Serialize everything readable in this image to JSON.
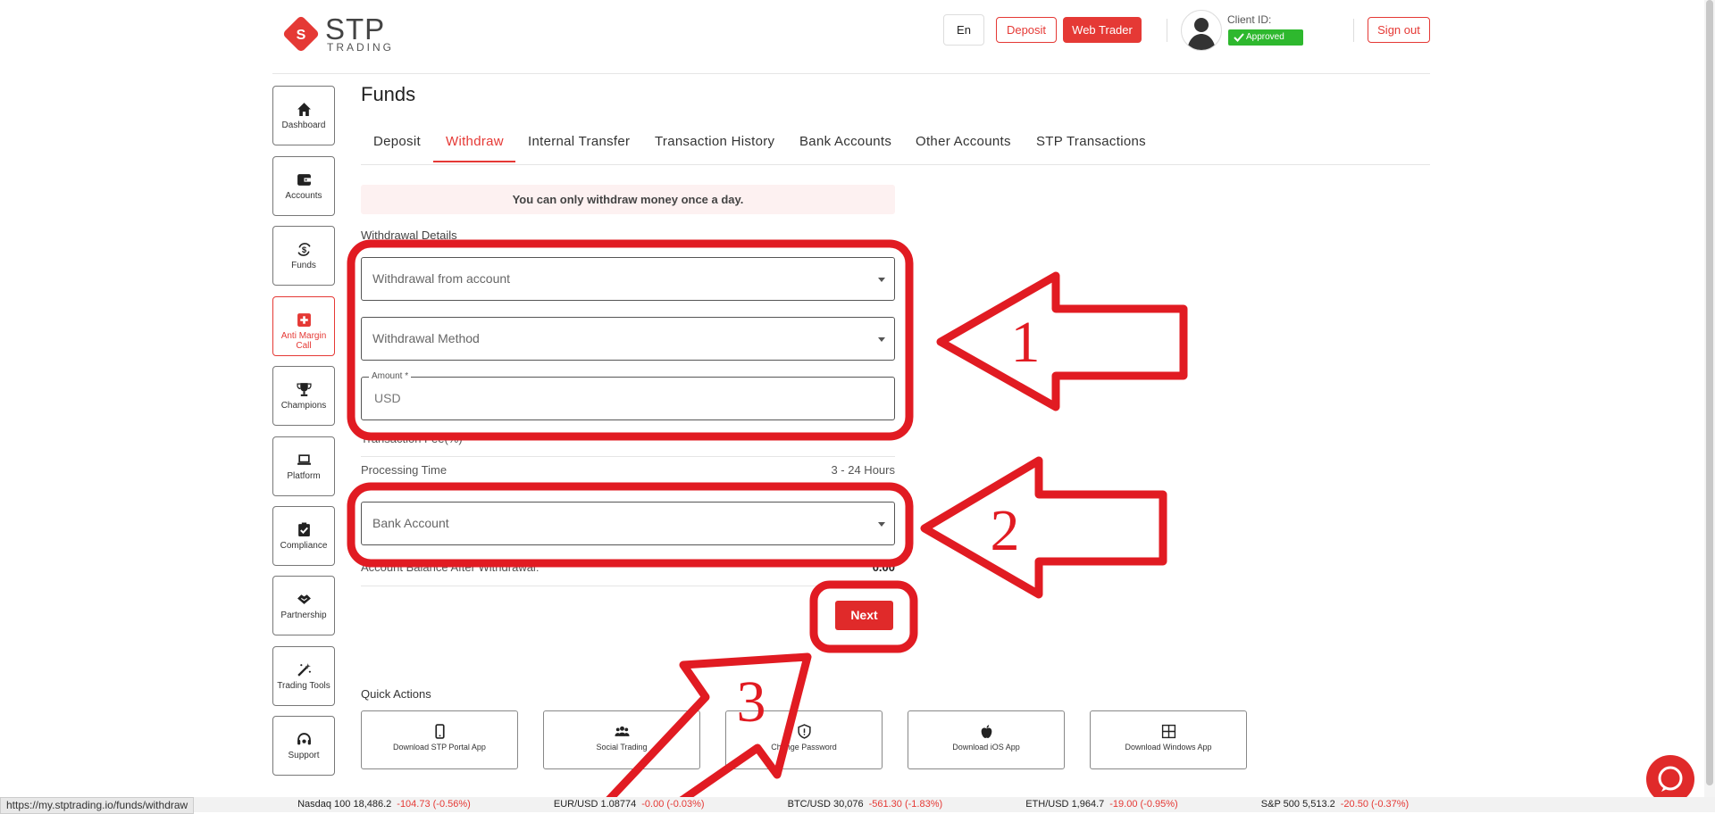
{
  "header": {
    "logo_main": "STP",
    "logo_sub": "TRADING",
    "lang": "En",
    "deposit": "Deposit",
    "web_trader": "Web Trader",
    "client_id_label": "Client ID:",
    "status": "Approved",
    "sign_out": "Sign out"
  },
  "sidebar": {
    "items": [
      {
        "label": "Dashboard",
        "icon": "home-icon"
      },
      {
        "label": "Accounts",
        "icon": "wallet-icon"
      },
      {
        "label": "Funds",
        "icon": "funds-icon"
      },
      {
        "label": "Anti Margin Call",
        "icon": "plus-box-icon"
      },
      {
        "label": "Champions",
        "icon": "trophy-icon"
      },
      {
        "label": "Platform",
        "icon": "laptop-icon"
      },
      {
        "label": "Compliance",
        "icon": "clipboard-check-icon"
      },
      {
        "label": "Partnership",
        "icon": "handshake-icon"
      },
      {
        "label": "Trading Tools",
        "icon": "magic-wand-icon"
      },
      {
        "label": "Support",
        "icon": "headset-icon"
      }
    ]
  },
  "page": {
    "title": "Funds",
    "tabs": [
      "Deposit",
      "Withdraw",
      "Internal Transfer",
      "Transaction History",
      "Bank Accounts",
      "Other Accounts",
      "STP Transactions"
    ],
    "active_tab": "Withdraw"
  },
  "form": {
    "notice": "You can only withdraw money once a day.",
    "section_label": "Withdrawal Details",
    "withdraw_from_placeholder": "Withdrawal from account",
    "method_placeholder": "Withdrawal Method",
    "amount_label": "Amount *",
    "amount_placeholder": "USD",
    "fee_label": "Transaction Fee(%)",
    "processing_label": "Processing Time",
    "processing_value": "3 - 24 Hours",
    "bank_placeholder": "Bank Account",
    "balance_label": "Account Balance After Withdrawal:",
    "balance_value": "0.00",
    "next": "Next"
  },
  "quick_actions": {
    "title": "Quick Actions",
    "items": [
      {
        "label": "Download STP Portal App",
        "icon": "smartphone-icon"
      },
      {
        "label": "Social Trading",
        "icon": "users-icon"
      },
      {
        "label": "Change Password",
        "icon": "shield-icon"
      },
      {
        "label": "Download iOS App",
        "icon": "apple-icon"
      },
      {
        "label": "Download Windows App",
        "icon": "windows-icon"
      }
    ]
  },
  "annotations": {
    "marker_1": "1",
    "marker_2": "2",
    "marker_3": "3",
    "color": "#e11b22"
  },
  "status_url": "https://my.stptrading.io/funds/withdraw",
  "ticker": [
    {
      "symbol": "Nasdaq 100",
      "price": "18,486.2",
      "change": "-104.73 (-0.56%)"
    },
    {
      "symbol": "EUR/USD",
      "price": "1.08774",
      "change": "-0.00 (-0.03%)"
    },
    {
      "symbol": "BTC/USD",
      "price": "30,076",
      "change": "-561.30 (-1.83%)"
    },
    {
      "symbol": "ETH/USD",
      "price": "1,964.7",
      "change": "-19.00 (-0.95%)"
    },
    {
      "symbol": "S&P 500",
      "price": "5,513.2",
      "change": "-20.50 (-0.37%)"
    }
  ],
  "colors": {
    "brand_red": "#e53935",
    "approved_green": "#2eb82e"
  }
}
